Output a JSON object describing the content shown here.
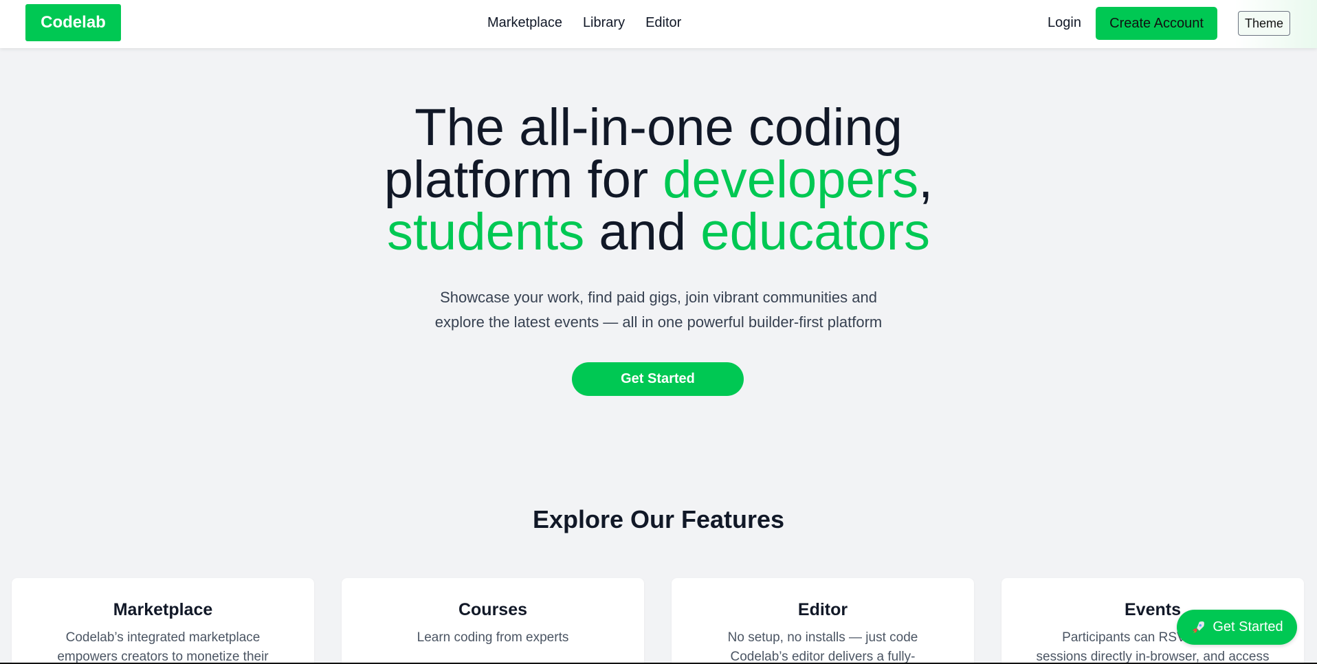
{
  "nav": {
    "logo": "Codelab",
    "links": [
      "Marketplace",
      "Library",
      "Editor"
    ],
    "login": "Login",
    "create_account": "Create Account",
    "theme": "Theme"
  },
  "hero": {
    "title_line1": "The all-in-one coding",
    "title_line2a": "platform for ",
    "title_line2b": "developers",
    "title_line2c": ",",
    "title_line3a": "students",
    "title_line3b": " and ",
    "title_line3c": "educators",
    "subtitle_line1": "Showcase your work, find paid gigs, join vibrant communities and",
    "subtitle_line2": "explore the latest events — all in one powerful builder-first platform",
    "cta": "Get Started"
  },
  "features": {
    "heading": "Explore Our Features",
    "cards": [
      {
        "title": "Marketplace",
        "desc": "Codelab’s integrated marketplace empowers creators to monetize their"
      },
      {
        "title": "Courses",
        "desc": "Learn coding from experts"
      },
      {
        "title": "Editor",
        "desc": "No setup, no installs — just code Codelab’s editor delivers a fully-"
      },
      {
        "title": "Events",
        "desc": "Participants can RSVP, join live sessions directly in-browser, and access event"
      }
    ]
  },
  "floating": {
    "label": "Get Started",
    "icon": "rocket-icon"
  },
  "colors": {
    "accent": "#00c853",
    "background": "#f2f3f5",
    "text": "#111827"
  }
}
